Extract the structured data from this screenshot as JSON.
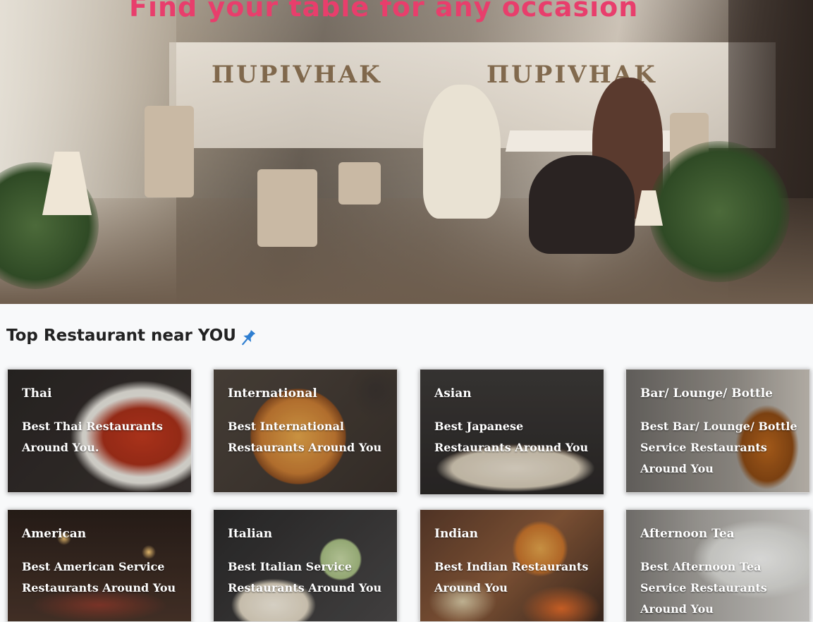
{
  "hero": {
    "title": "Find your table for any occasion"
  },
  "section": {
    "title": "Top Restaurant near YOU",
    "icon": "pin-icon",
    "icon_color": "#2f7fd1"
  },
  "colors": {
    "accent": "#e83e6c",
    "heading": "#222222",
    "card_text": "#ffffff",
    "page_bg": "#f8f9fa"
  },
  "cards": [
    {
      "category": "Thai",
      "description": "Best Thai Restaurants Around You."
    },
    {
      "category": "International",
      "description": "Best International Restaurants Around You"
    },
    {
      "category": "Asian",
      "description": "Best Japanese Restaurants Around You"
    },
    {
      "category": "Bar/ Lounge/ Bottle",
      "description": "Best Bar/ Lounge/ Bottle Service Restaurants Around You"
    },
    {
      "category": "American",
      "description": "Best American Service Restaurants Around You"
    },
    {
      "category": "Italian",
      "description": "Best Italian Service Restaurants Around You"
    },
    {
      "category": "Indian",
      "description": "Best Indian Restaurants Around You"
    },
    {
      "category": "Afternoon Tea",
      "description": "Best Afternoon Tea Service Restaurants Around You"
    }
  ]
}
